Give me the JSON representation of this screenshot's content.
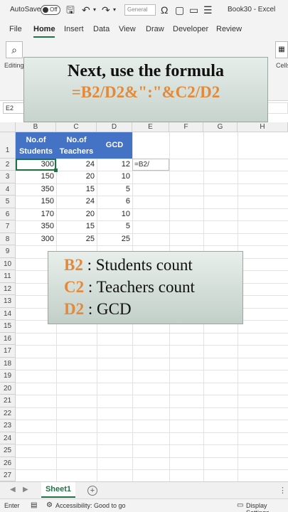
{
  "titlebar": {
    "autosave_label": "AutoSave",
    "autosave_state": "Off",
    "number_format": "General",
    "workbook_title": "Book30 - Excel"
  },
  "ribbon": {
    "tabs": [
      "File",
      "Home",
      "Insert",
      "Data",
      "View",
      "Draw",
      "Developer",
      "Review"
    ],
    "active_tab": "Home",
    "group_editing": "Editing",
    "group_cells": "Cells"
  },
  "namebox": "E2",
  "columns": [
    "B",
    "C",
    "D",
    "E",
    "F",
    "G",
    "H"
  ],
  "rows": [
    "1",
    "2",
    "3",
    "4",
    "5",
    "6",
    "7",
    "8",
    "9",
    "10",
    "11",
    "12",
    "13",
    "14",
    "15",
    "16",
    "17",
    "18",
    "19",
    "20",
    "21",
    "22",
    "23",
    "24",
    "25",
    "26",
    "27"
  ],
  "table": {
    "headers": [
      "No.of Students",
      "No.of Teachers",
      "GCD"
    ],
    "rows": [
      [
        300,
        24,
        12
      ],
      [
        150,
        20,
        10
      ],
      [
        350,
        15,
        5
      ],
      [
        150,
        24,
        6
      ],
      [
        170,
        20,
        10
      ],
      [
        350,
        15,
        5
      ],
      [
        300,
        25,
        25
      ]
    ]
  },
  "editing_cell_text": "=B2/",
  "overlay_top": {
    "line1": "Next, use the formula",
    "line2": "=B2/D2&\":\"&C2/D2"
  },
  "overlay_bottom": {
    "items": [
      {
        "key": "B2",
        "sep": " : ",
        "desc": "Students count"
      },
      {
        "key": "C2",
        "sep": " : ",
        "desc": "Teachers count"
      },
      {
        "key": "D2",
        "sep": " : ",
        "desc": "GCD"
      }
    ]
  },
  "sheet": {
    "tab_name": "Sheet1",
    "add_symbol": "+",
    "more_symbol": "⋮"
  },
  "status": {
    "mode": "Enter",
    "accessibility": "Accessibility: Good to go",
    "display_settings": "Display Settings"
  },
  "colors": {
    "excel_green": "#217346",
    "table_header_blue": "#4472c4",
    "accent_orange": "#e4893a"
  }
}
